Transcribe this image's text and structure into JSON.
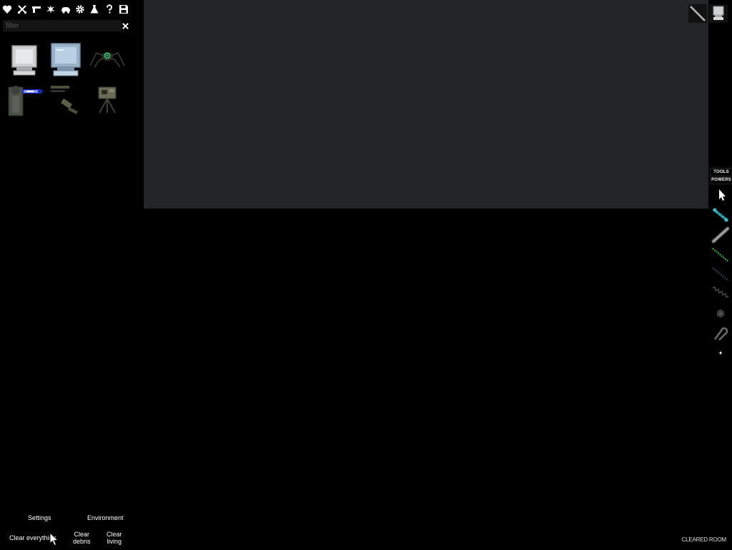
{
  "categories": [
    {
      "icon": "heart-icon"
    },
    {
      "icon": "crossed-swords-icon"
    },
    {
      "icon": "gun-icon"
    },
    {
      "icon": "explosion-icon"
    },
    {
      "icon": "vehicle-icon"
    },
    {
      "icon": "gear-icon"
    },
    {
      "icon": "flask-icon"
    },
    {
      "icon": "question-icon"
    },
    {
      "icon": "save-icon"
    }
  ],
  "filter": {
    "placeholder": "filter",
    "value": ""
  },
  "items": [
    {
      "icon": "monitor-white-icon"
    },
    {
      "icon": "monitor-blue-icon"
    },
    {
      "icon": "spider-robot-icon"
    },
    {
      "icon": "laser-turret-icon"
    },
    {
      "icon": "gun-parts-icon"
    },
    {
      "icon": "camera-tripod-icon"
    }
  ],
  "bottom_buttons": {
    "settings": "Settings",
    "environment": "Environment",
    "clear_everything": "Clear everything",
    "clear_debris_line1": "Clear",
    "clear_debris_line2": "debris",
    "clear_living_line1": "Clear",
    "clear_living_line2": "living"
  },
  "top_right": [
    {
      "icon": "rod-icon"
    },
    {
      "icon": "monitor-icon"
    }
  ],
  "toolbar": {
    "tools_label": "TOOLS",
    "powers_label": "POWERS",
    "tools": [
      {
        "icon": "pointer-icon"
      },
      {
        "icon": "teal-cable-icon"
      },
      {
        "icon": "rod-icon"
      },
      {
        "icon": "green-rope-icon"
      },
      {
        "icon": "dark-spring-icon"
      },
      {
        "icon": "zigzag-spring-icon"
      },
      {
        "icon": "hexagon-bolt-icon"
      },
      {
        "icon": "hook-icon"
      },
      {
        "icon": "small-star-icon"
      }
    ]
  },
  "status": "CLEARED ROOM",
  "colors": {
    "background": "#000000",
    "room": "#242529",
    "teal_tool": "#3bbcc4",
    "green_tool": "#3ad34a",
    "laser": "#3a5bff"
  }
}
